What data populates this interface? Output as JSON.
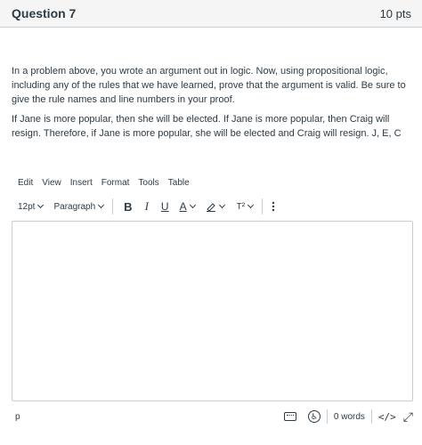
{
  "question": {
    "title": "Question 7",
    "points": "10 pts",
    "paragraph1": "In a problem above, you wrote an argument out in logic. Now, using propositional logic, including any of the rules that we have learned, prove that the argument is valid.  Be sure to give the rule names and line numbers in your proof.",
    "paragraph2": "If Jane is more popular, then she will be elected. If Jane is more popular, then Craig will resign. Therefore, if Jane is more popular, she will be elected and Craig will resign. J, E, C"
  },
  "menubar": {
    "edit": "Edit",
    "view": "View",
    "insert": "Insert",
    "format": "Format",
    "tools": "Tools",
    "table": "Table"
  },
  "toolbar": {
    "font_size": "12pt",
    "block_format": "Paragraph",
    "bold": "B",
    "italic": "I",
    "underline": "U",
    "text_color": "A",
    "superscript": "T²"
  },
  "statusbar": {
    "path": "p",
    "word_count": "0 words",
    "html_editor": "</>"
  },
  "icons": {
    "keyboard": "keyboard-icon",
    "accessibility": "accessibility-checker-icon",
    "fullscreen": "fullscreen-icon",
    "highlight": "highlighter-icon",
    "more": "more-options-icon"
  }
}
